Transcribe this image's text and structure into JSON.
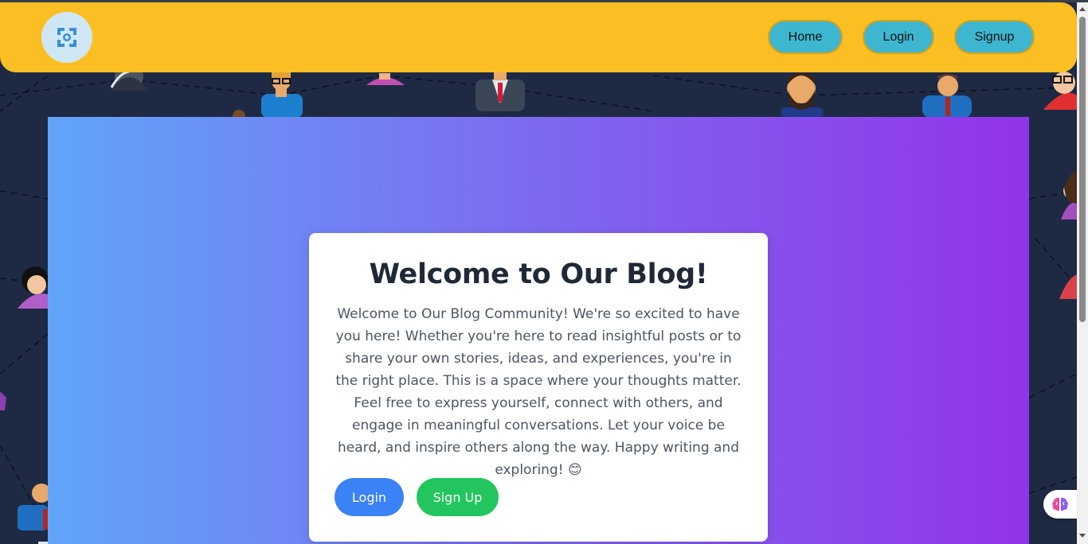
{
  "navbar": {
    "logo_icon": "logo-icon",
    "home_label": "Home",
    "login_label": "Login",
    "signup_label": "Signup",
    "background_color": "#fbbf24",
    "button_color": "#3eb6cf"
  },
  "hero": {
    "gradient_start": "#60a5fa",
    "gradient_end": "#9333ea"
  },
  "card": {
    "title": "Welcome to Our Blog!",
    "body": "Welcome to Our Blog Community! We're so excited to have you here! Whether you're here to read insightful posts or to share your own stories, ideas, and experiences, you're in the right place. This is a space where your thoughts matter. Feel free to express yourself, connect with others, and engage in meaningful conversations. Let your voice be heard, and inspire others along the way. Happy writing and exploring! 😊",
    "login_label": "Login",
    "signup_label": "Sign Up",
    "login_color": "#3b82f6",
    "signup_color": "#22c55e"
  },
  "widget": {
    "icon": "brain-icon"
  }
}
